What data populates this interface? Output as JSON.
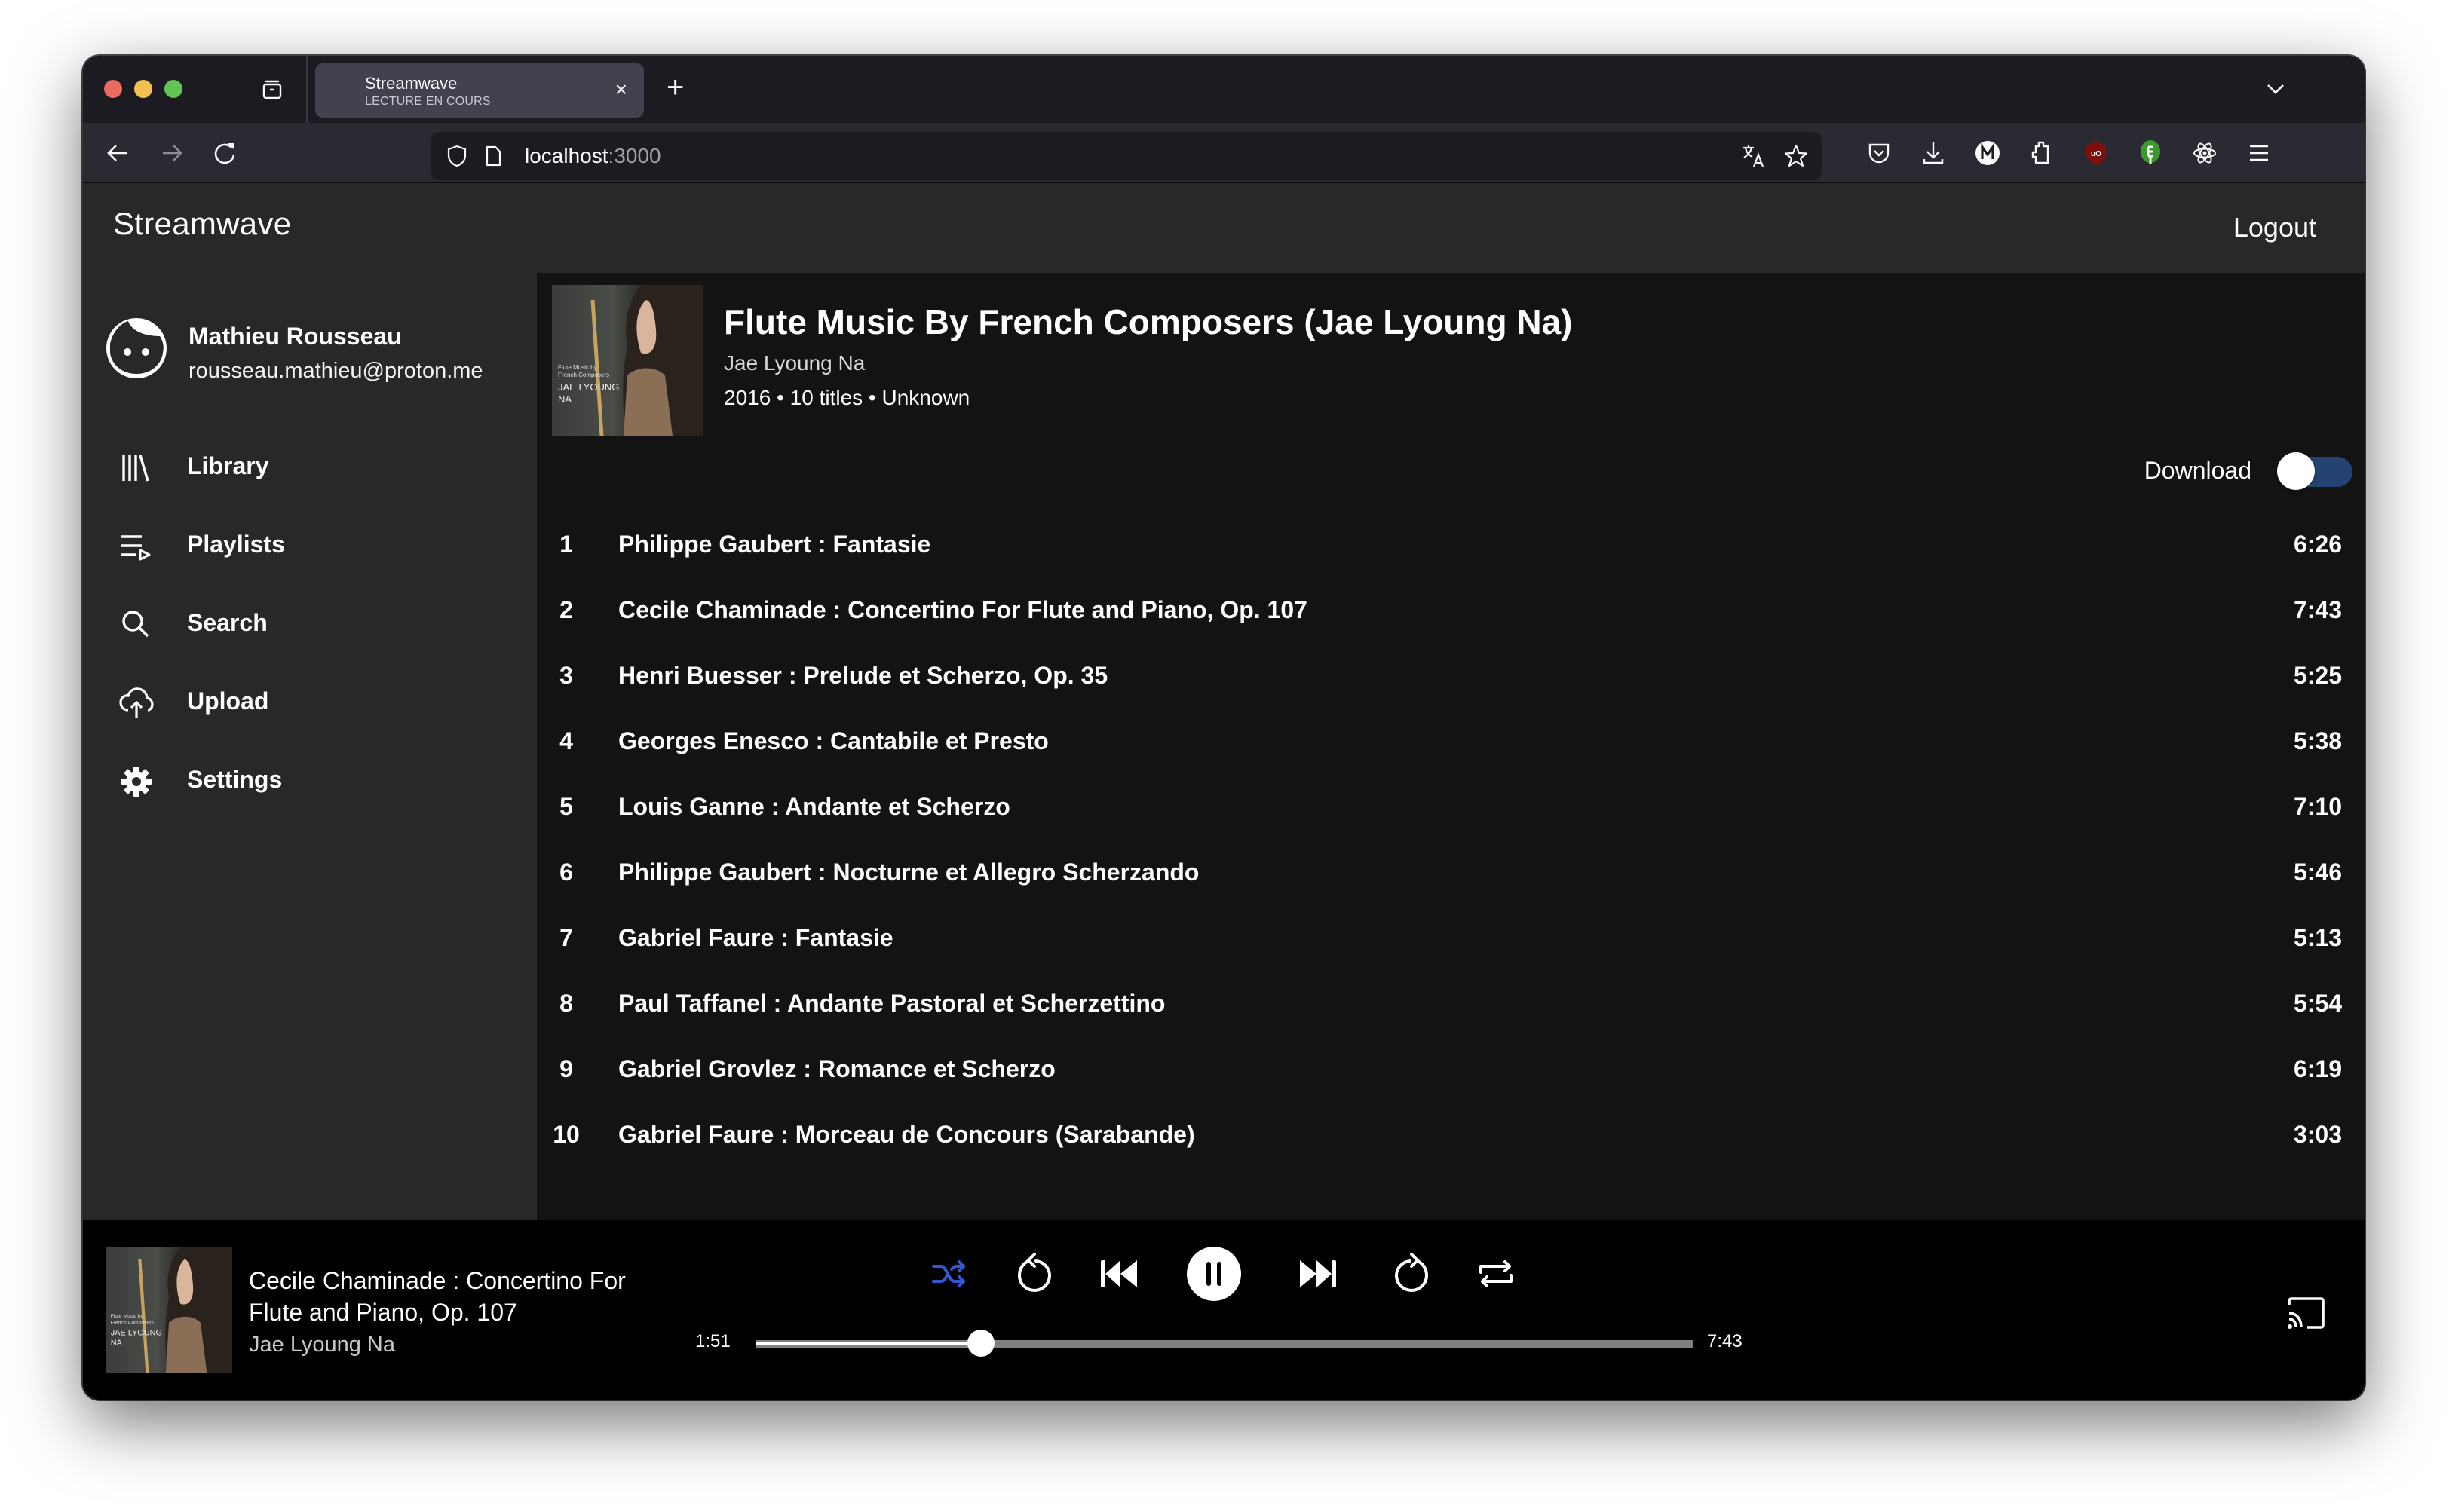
{
  "browser": {
    "tab": {
      "title": "Streamwave",
      "subtitle": "LECTURE EN COURS"
    },
    "url": {
      "host": "localhost",
      "port": ":3000"
    },
    "extensions": [
      "pocket-icon",
      "download-icon",
      "m-extension-icon",
      "extensions-puzzle-icon",
      "ublock-icon",
      "green-extension-icon",
      "react-devtools-icon",
      "menu-icon"
    ]
  },
  "app": {
    "brand": "Streamwave",
    "logout_label": "Logout"
  },
  "user": {
    "name": "Mathieu Rousseau",
    "email": "rousseau.mathieu@proton.me"
  },
  "sidebar": {
    "items": [
      {
        "label": "Library",
        "icon": "library-icon"
      },
      {
        "label": "Playlists",
        "icon": "playlist-icon"
      },
      {
        "label": "Search",
        "icon": "search-icon"
      },
      {
        "label": "Upload",
        "icon": "upload-cloud-icon"
      },
      {
        "label": "Settings",
        "icon": "gear-icon"
      }
    ]
  },
  "album": {
    "title": "Flute Music By French Composers (Jae Lyoung Na)",
    "artist": "Jae Lyoung Na",
    "meta": "2016 • 10 titles • Unknown",
    "cover_text": {
      "line1": "Flute Music by",
      "line2": "French Composers",
      "line3": "JAE LYOUNG",
      "line4": "NA"
    },
    "download_label": "Download",
    "download_enabled": false
  },
  "tracks": [
    {
      "num": "1",
      "title": "Philippe Gaubert : Fantasie",
      "duration": "6:26"
    },
    {
      "num": "2",
      "title": "Cecile Chaminade : Concertino For Flute and Piano, Op. 107",
      "duration": "7:43"
    },
    {
      "num": "3",
      "title": "Henri Buesser : Prelude et Scherzo, Op. 35",
      "duration": "5:25"
    },
    {
      "num": "4",
      "title": "Georges Enesco : Cantabile et Presto",
      "duration": "5:38"
    },
    {
      "num": "5",
      "title": "Louis Ganne : Andante et Scherzo",
      "duration": "7:10"
    },
    {
      "num": "6",
      "title": "Philippe Gaubert : Nocturne et Allegro Scherzando",
      "duration": "5:46"
    },
    {
      "num": "7",
      "title": "Gabriel Faure : Fantasie",
      "duration": "5:13"
    },
    {
      "num": "8",
      "title": "Paul Taffanel : Andante Pastoral et Scherzettino",
      "duration": "5:54"
    },
    {
      "num": "9",
      "title": "Gabriel Grovlez : Romance et Scherzo",
      "duration": "6:19"
    },
    {
      "num": "10",
      "title": "Gabriel Faure : Morceau de Concours (Sarabande)",
      "duration": "3:03"
    }
  ],
  "player": {
    "title": "Cecile Chaminade : Concertino For Flute and Piano, Op. 107",
    "artist": "Jae Lyoung Na",
    "elapsed": "1:51",
    "total": "7:43",
    "progress_fraction": 0.24,
    "shuffle_active": true,
    "state": "playing",
    "colors": {
      "accent": "#3557d4",
      "toggle_track": "#244372"
    }
  }
}
